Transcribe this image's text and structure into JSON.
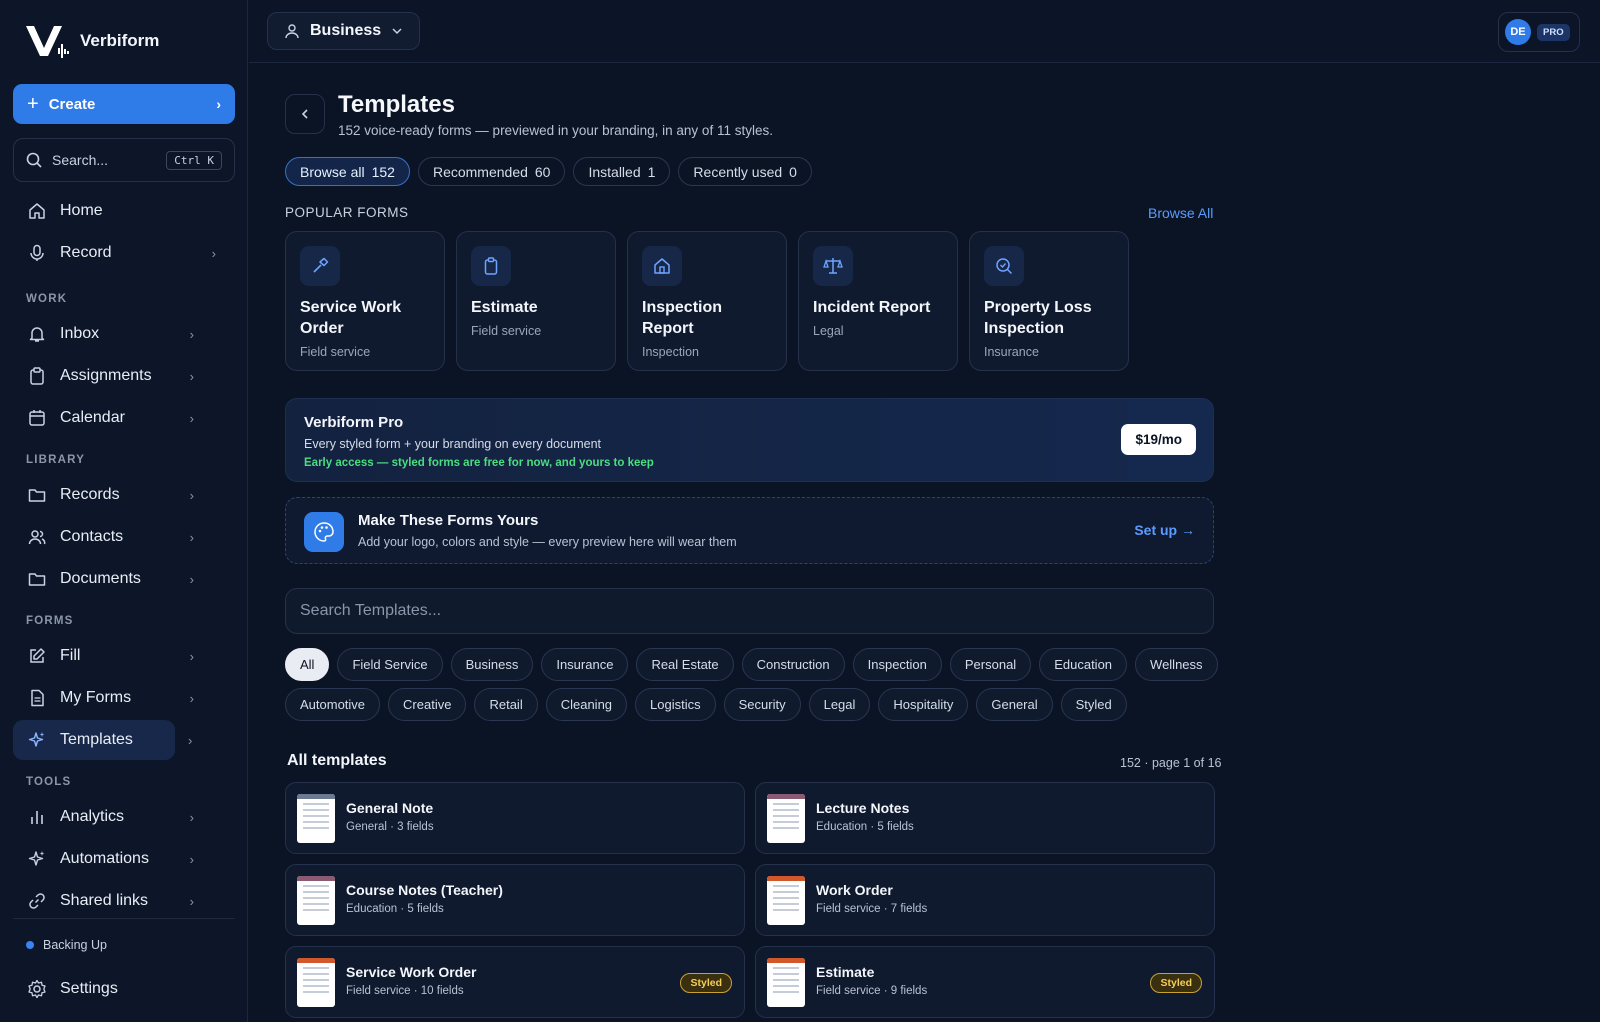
{
  "brand": {
    "name": "Verbiform"
  },
  "sidebar": {
    "create_label": "Create",
    "search_placeholder": "Search...",
    "search_shortcut": "Ctrl K",
    "items_top": [
      {
        "label": "Home",
        "icon": "home-icon"
      },
      {
        "label": "Record",
        "icon": "mic-icon"
      }
    ],
    "sections": {
      "work": "WORK",
      "library": "LIBRARY",
      "forms": "FORMS",
      "tools": "TOOLS"
    },
    "work_items": [
      {
        "label": "Inbox",
        "icon": "bell-icon"
      },
      {
        "label": "Assignments",
        "icon": "clipboard-icon"
      },
      {
        "label": "Calendar",
        "icon": "calendar-icon"
      }
    ],
    "library_items": [
      {
        "label": "Records",
        "icon": "folder-icon"
      },
      {
        "label": "Contacts",
        "icon": "users-icon"
      },
      {
        "label": "Documents",
        "icon": "folder-icon"
      }
    ],
    "forms_items": [
      {
        "label": "Fill",
        "icon": "edit-icon"
      },
      {
        "label": "My Forms",
        "icon": "file-icon"
      },
      {
        "label": "Templates",
        "icon": "sparkle-icon",
        "active": true
      }
    ],
    "tools_items": [
      {
        "label": "Analytics",
        "icon": "bar-chart-icon"
      },
      {
        "label": "Automations",
        "icon": "sparkle-icon"
      },
      {
        "label": "Shared links",
        "icon": "link-icon"
      }
    ],
    "status": "Backing Up",
    "settings_label": "Settings"
  },
  "topbar": {
    "workspace": "Business",
    "user_initials": "DE",
    "plan_badge": "PRO"
  },
  "page": {
    "title": "Templates",
    "subtitle": "152 voice-ready forms — previewed in your branding, in any of 11 styles.",
    "tabs": [
      {
        "label": "Browse all",
        "count": "152",
        "active": true
      },
      {
        "label": "Recommended",
        "count": "60"
      },
      {
        "label": "Installed",
        "count": "1"
      },
      {
        "label": "Recently used",
        "count": "0"
      }
    ],
    "popular_label": "POPULAR FORMS",
    "browse_all": "Browse All",
    "popular": [
      {
        "title": "Service Work Order",
        "category": "Field service",
        "icon": "hammer-icon"
      },
      {
        "title": "Estimate",
        "category": "Field service",
        "icon": "clipboard-icon"
      },
      {
        "title": "Inspection Report",
        "category": "Inspection",
        "icon": "house-icon"
      },
      {
        "title": "Incident Report",
        "category": "Legal",
        "icon": "scale-icon"
      },
      {
        "title": "Property Loss Inspection",
        "category": "Insurance",
        "icon": "search-check-icon"
      }
    ],
    "pro_banner": {
      "title": "Verbiform Pro",
      "subtitle": "Every styled form + your branding on every document",
      "note": "Early access — styled forms are free for now, and yours to keep",
      "price": "$19/mo"
    },
    "brand_card": {
      "title": "Make These Forms Yours",
      "subtitle": "Add your logo, colors and style — every preview here will wear them",
      "action": "Set up →"
    },
    "template_search_placeholder": "Search Templates...",
    "categories_row1": [
      "All",
      "Field Service",
      "Business",
      "Insurance",
      "Real Estate",
      "Construction",
      "Inspection",
      "Personal",
      "Education",
      "Wellness"
    ],
    "categories_row2": [
      "Automotive",
      "Creative",
      "Retail",
      "Cleaning",
      "Logistics",
      "Security",
      "Legal",
      "Hospitality",
      "General",
      "Styled"
    ],
    "all_title": "All templates",
    "all_count": "152 · page 1 of 16",
    "templates": [
      {
        "title": "General Note",
        "meta": "General · 3 fields",
        "accent": "#6b7a90",
        "styled": false
      },
      {
        "title": "Lecture Notes",
        "meta": "Education · 5 fields",
        "accent": "#8a5a72",
        "styled": false
      },
      {
        "title": "Course Notes (Teacher)",
        "meta": "Education · 5 fields",
        "accent": "#8a5a72",
        "styled": false
      },
      {
        "title": "Work Order",
        "meta": "Field service · 7 fields",
        "accent": "#d2572b",
        "styled": false
      },
      {
        "title": "Service Work Order",
        "meta": "Field service · 10 fields",
        "accent": "#d2572b",
        "styled": true
      },
      {
        "title": "Estimate",
        "meta": "Field service · 9 fields",
        "accent": "#d2572b",
        "styled": true
      }
    ],
    "styled_badge": "Styled"
  }
}
